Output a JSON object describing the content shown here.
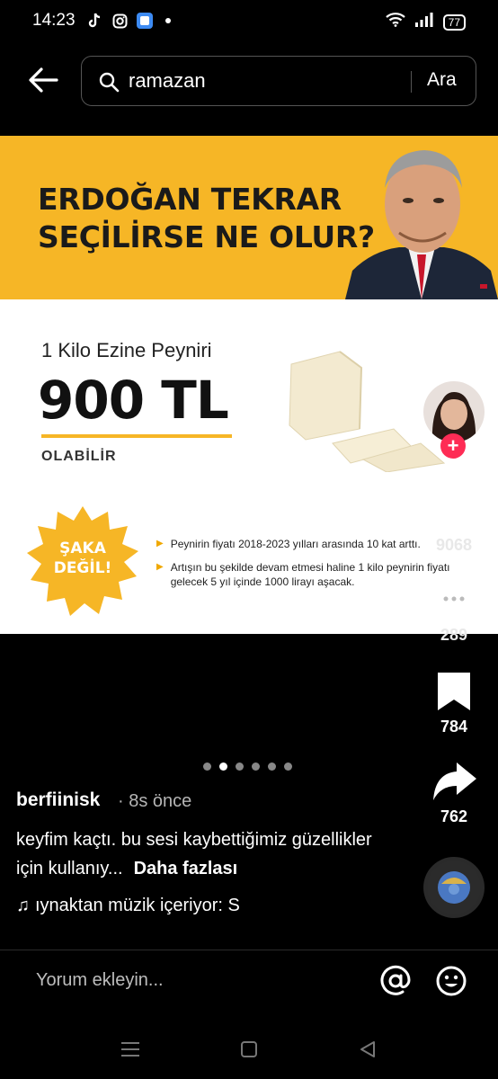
{
  "status_bar": {
    "time": "14:23",
    "battery": "77",
    "app_icons": [
      "tiktok-icon",
      "instagram-icon",
      "app-icon"
    ]
  },
  "search": {
    "query": "ramazan",
    "submit_label": "Ara"
  },
  "post_image": {
    "headline_line1": "ERDOĞAN TEKRAR",
    "headline_line2": "SEÇİLİRSE NE OLUR?",
    "product": "1 Kilo Ezine Peyniri",
    "price": "900 TL",
    "maybe": "OLABİLİR",
    "joke_line1": "ŞAKA",
    "joke_line2": "DEĞİL!",
    "bullet1": "Peynirin fiyatı 2018-2023 yılları arasında 10 kat arttı.",
    "bullet2": "Artışın bu şekilde devam etmesi haline 1 kilo peynirin fiyatı gelecek 5 yıl içinde 1000 lirayı aşacak.",
    "colors": {
      "brand_yellow": "#f6b626"
    }
  },
  "actions": {
    "likes": "9068",
    "comments": "289",
    "saves": "784",
    "shares": "762"
  },
  "carousel": {
    "count": 6,
    "active_index": 1
  },
  "post": {
    "author": "berfiinisk",
    "time_ago": "· 8s önce",
    "caption": "keyfim kaçtı. bu sesi kaybettiğimiz güzellikler için kullanıy...",
    "more_label": "Daha fazlası",
    "music": "ıynaktan müzik içeriyor: S"
  },
  "comment_bar": {
    "placeholder": "Yorum ekleyin..."
  },
  "accent_color": "#fe2c55"
}
